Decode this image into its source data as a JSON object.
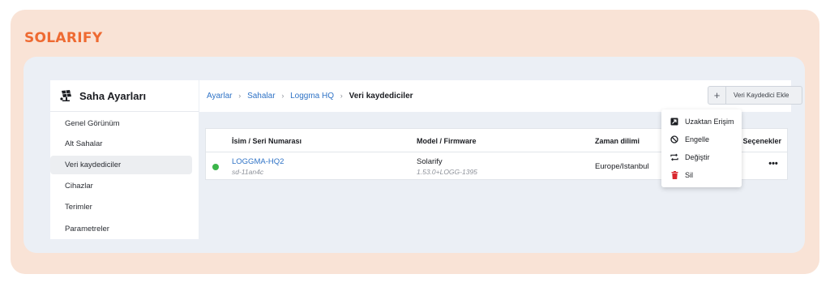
{
  "brand": {
    "name": "SOLARIFY"
  },
  "sidebar": {
    "title": "Saha Ayarları",
    "items": [
      {
        "label": "Genel Görünüm"
      },
      {
        "label": "Alt Sahalar"
      },
      {
        "label": "Veri kaydediciler",
        "active": true
      },
      {
        "label": "Cihazlar"
      },
      {
        "label": "Terimler"
      },
      {
        "label": "Parametreler"
      }
    ]
  },
  "breadcrumb": {
    "items": [
      "Ayarlar",
      "Sahalar",
      "Loggma HQ"
    ],
    "current": "Veri kaydediciler",
    "separator": "›"
  },
  "toolbar": {
    "add_label": "Veri Kaydedici Ekle",
    "add_icon": "+"
  },
  "table": {
    "columns": {
      "name": "İsim / Seri Numarası",
      "model": "Model / Firmware",
      "timezone": "Zaman dilimi",
      "options": "Seçenekler"
    },
    "rows": [
      {
        "status_color": "#3bb54a",
        "name": "LOGGMA-HQ2",
        "serial": "sd-11an4c",
        "model": "Solarify",
        "firmware": "1.53.0+LOGG-1395",
        "timezone": "Europe/Istanbul",
        "options_icon": "•••"
      }
    ]
  },
  "context_menu": {
    "items": [
      {
        "label": "Uzaktan Erişim",
        "icon": "remote-access-icon"
      },
      {
        "label": "Engelle",
        "icon": "block-icon"
      },
      {
        "label": "Değiştir",
        "icon": "swap-icon"
      },
      {
        "label": "Sil",
        "icon": "trash-icon",
        "color": "#d9272e"
      }
    ]
  },
  "colors": {
    "accent": "#ee6a32",
    "link": "#2f73c6",
    "outer_bg": "#f9e3d6",
    "app_bg": "#ebeff5",
    "danger": "#d9272e",
    "status_online": "#3bb54a"
  }
}
